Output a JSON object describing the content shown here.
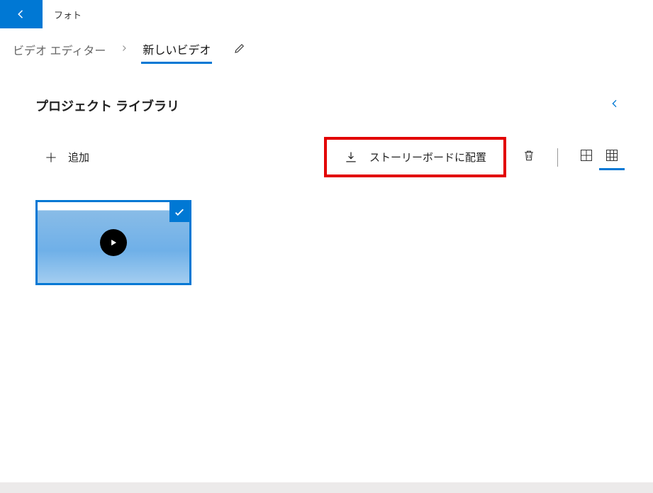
{
  "app": {
    "title": "フォト"
  },
  "breadcrumb": {
    "item1": "ビデオ エディター",
    "item2": "新しいビデオ"
  },
  "section": {
    "title": "プロジェクト ライブラリ"
  },
  "toolbar": {
    "add_label": "追加",
    "storyboard_label": "ストーリーボードに配置"
  }
}
